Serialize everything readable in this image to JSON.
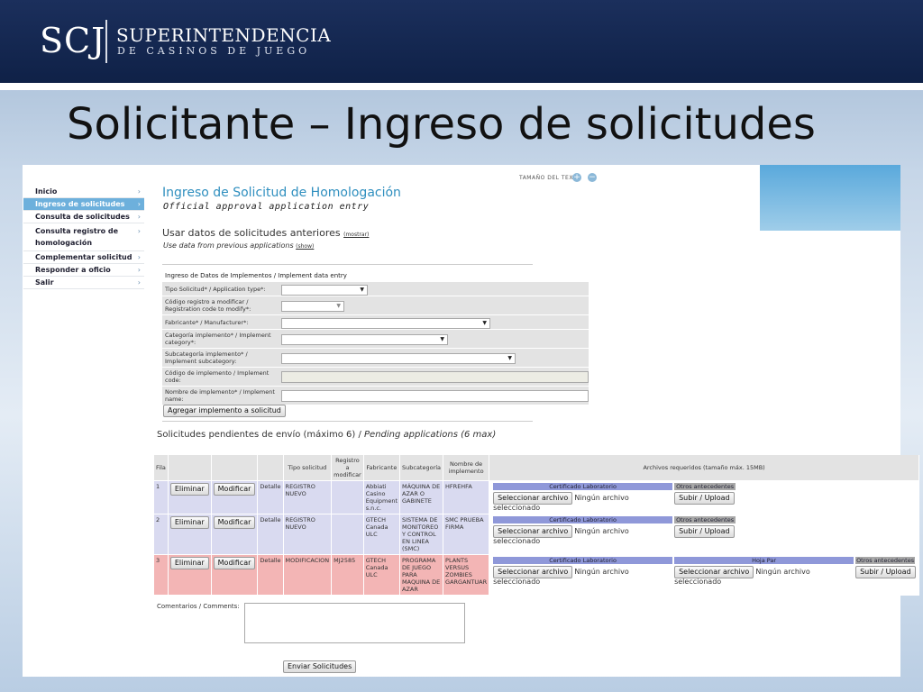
{
  "header": {
    "logo_mark": "SCJ",
    "logo_line1": "SUPERINTENDENCIA",
    "logo_line2": "DE CASINOS DE JUEGO"
  },
  "slide_title": "Solicitante – Ingreso de solicitudes",
  "colors": {
    "header_bg": "#0f2147",
    "link_blue": "#2f8fbf",
    "active_nav": "#6db0dc",
    "row_blue": "#d9daf0",
    "row_red": "#f3b5b5",
    "file_head": "#8f98d9"
  },
  "text_size": {
    "label": "TAMAÑO DEL TEXTO",
    "increase": "+",
    "decrease": "−"
  },
  "sidebar": {
    "items": [
      {
        "label": "Inicio",
        "chevron": "›"
      },
      {
        "label": "Ingreso de solicitudes",
        "chevron": "›"
      },
      {
        "label": "Consulta de solicitudes",
        "chevron": "›"
      },
      {
        "label": "Consulta registro de homologación",
        "chevron": "›"
      },
      {
        "label": "Complementar solicitud",
        "chevron": "›"
      },
      {
        "label": "Responder a oficio",
        "chevron": "›"
      },
      {
        "label": "Salir",
        "chevron": "›"
      }
    ]
  },
  "page": {
    "title": "Ingreso de Solicitud de Homologación",
    "subtitle": "Official approval application entry",
    "use_prev": "Usar datos de solicitudes anteriores",
    "use_prev_link": "(mostrar)",
    "use_prev_en": "Use data from previous applications",
    "use_prev_en_link": "(show)"
  },
  "form": {
    "caption": "Ingreso de Datos de Implementos / Implement data entry",
    "fields": [
      {
        "label": "Tipo Solicitud* / Application type*:"
      },
      {
        "label": "Código registro a modificar / Registration code to modify*:"
      },
      {
        "label": "Fabricante* / Manufacturer*:"
      },
      {
        "label": "Categoría implemento* / Implement category*:"
      },
      {
        "label": "Subcategoría implemento* / Implement subcategory:"
      },
      {
        "label": "Código de implemento / Implement code:"
      },
      {
        "label": "Nombre de implemento* / Implement name:"
      }
    ],
    "add_button": "Agregar implemento a solicitud"
  },
  "pending": {
    "title_es": "Solicitudes pendientes de envío (máximo 6) /",
    "title_en": "Pending applications (6 max)",
    "headers": {
      "fila": "Fila",
      "tipo": "Tipo solicitud",
      "registro": "Registro a modificar",
      "fabricante": "Fabricante",
      "subcategoria": "Subcategoría",
      "nombre": "Nombre de implemento",
      "archivos": "Archivos requeridos (tamaño máx. 15MB)"
    },
    "delete_label": "Eliminar",
    "modify_label": "Modificar",
    "detail_label": "Detalle",
    "file_select": "Seleccionar archivo",
    "no_file": "Ningún archivo seleccionado",
    "upload": "Subir / Upload",
    "cert_lab": "Certificado Laboratorio",
    "otros": "Otros antecedentes",
    "hoja_par": "Hoja Par",
    "rows": [
      {
        "fila": "1",
        "tipo": "REGISTRO NUEVO",
        "registro": "",
        "fabricante": "Abbiati Casino Equipment s.n.c.",
        "subcategoria": "MÁQUINA DE AZAR O GABINETE",
        "nombre": "HFREHFA"
      },
      {
        "fila": "2",
        "tipo": "REGISTRO NUEVO",
        "registro": "",
        "fabricante": "GTECH Canada ULC",
        "subcategoria": "SISTEMA DE MONITOREO Y CONTROL EN LINEA (SMC)",
        "nombre": "SMC PRUEBA FIRMA"
      },
      {
        "fila": "3",
        "tipo": "MODIFICACION",
        "registro": "MJ2585",
        "fabricante": "GTECH Canada ULC",
        "subcategoria": "PROGRAMA DE JUEGO PARA MAQUINA DE AZAR",
        "nombre": "PLANTS VERSUS ZOMBIES GARGANTUAR"
      }
    ]
  },
  "comments_label": "Comentarios / Comments:",
  "send_button": "Enviar Solicitudes"
}
